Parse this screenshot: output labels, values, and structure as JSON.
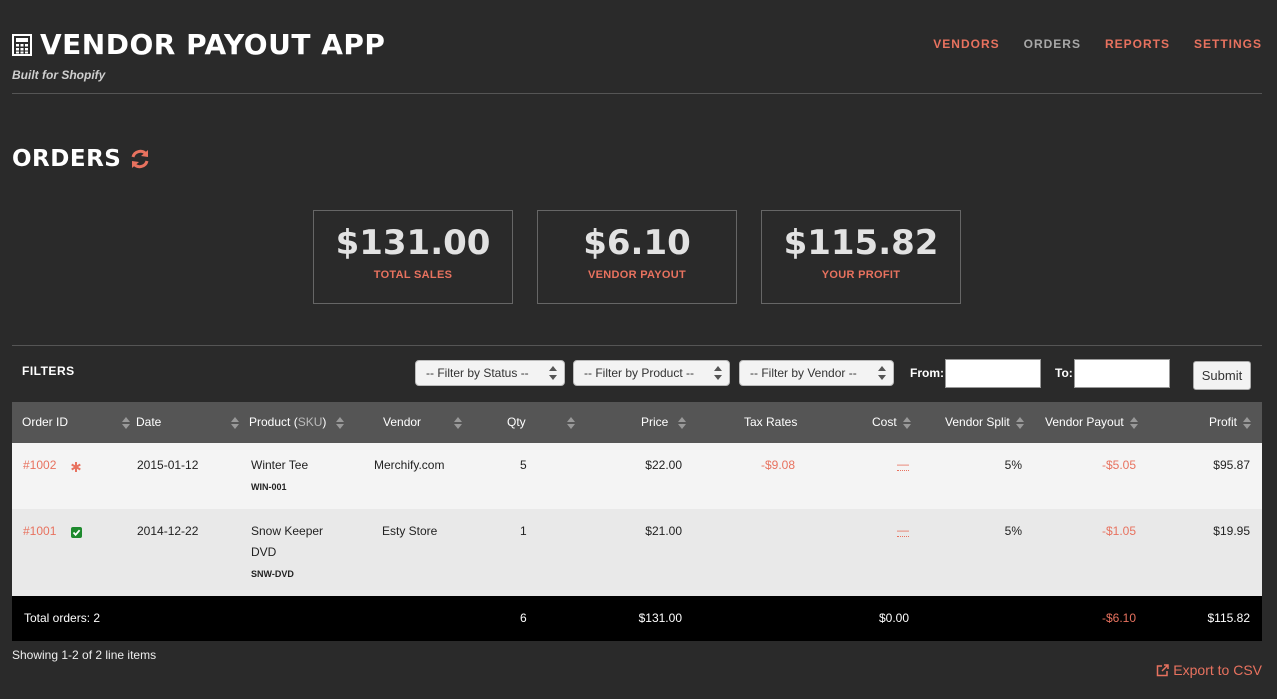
{
  "header": {
    "app_title": "VENDOR PAYOUT APP",
    "subtitle": "Built for Shopify",
    "nav": [
      {
        "label": "VENDORS",
        "active": false
      },
      {
        "label": "ORDERS",
        "active": true
      },
      {
        "label": "REPORTS",
        "active": false
      },
      {
        "label": "SETTINGS",
        "active": false
      }
    ]
  },
  "page": {
    "title": "ORDERS"
  },
  "stats": [
    {
      "value": "$131.00",
      "label": "TOTAL SALES"
    },
    {
      "value": "$6.10",
      "label": "VENDOR PAYOUT"
    },
    {
      "value": "$115.82",
      "label": "YOUR PROFIT"
    }
  ],
  "filters": {
    "label": "FILTERS",
    "status": "-- Filter by Status --",
    "product": "-- Filter by Product --",
    "vendor": "-- Filter by Vendor --",
    "from_label": "From:",
    "to_label": "To:",
    "submit": "Submit"
  },
  "table": {
    "columns": {
      "order_id": "Order ID",
      "date": "Date",
      "product": "Product (",
      "product_sku": "SKU",
      "product_close": ")",
      "vendor": "Vendor",
      "qty": "Qty",
      "price": "Price",
      "tax_rates": "Tax Rates",
      "cost": "Cost",
      "vendor_split": "Vendor Split",
      "vendor_payout": "Vendor Payout",
      "profit": "Profit"
    },
    "rows": [
      {
        "order_id": "#1002",
        "status_icon": "asterisk-icon",
        "date": "2015-01-12",
        "product_line1": "Winter Tee",
        "product_line2": "",
        "sku": "WIN-001",
        "vendor": "Merchify.com",
        "qty": "5",
        "price": "$22.00",
        "tax": "-$9.08",
        "cost": "—",
        "split": "5%",
        "payout": "-$5.05",
        "profit": "$95.87"
      },
      {
        "order_id": "#1001",
        "status_icon": "check-square-icon",
        "date": "2014-12-22",
        "product_line1": "Snow Keeper",
        "product_line2": "DVD",
        "sku": "SNW-DVD",
        "vendor": "Esty Store",
        "qty": "1",
        "price": "$21.00",
        "tax": "",
        "cost": "—",
        "split": "5%",
        "payout": "-$1.05",
        "profit": "$19.95"
      }
    ],
    "footer": {
      "total_orders": "Total orders: 2",
      "qty": "6",
      "price": "$131.00",
      "cost": "$0.00",
      "payout": "-$6.10",
      "profit": "$115.82"
    }
  },
  "showing": "Showing 1-2 of 2 line items",
  "export": "Export to CSV",
  "colors": {
    "background": "#2a2a2a",
    "accent": "#e8725f",
    "table_header": "#555555",
    "success": "#1e8a2e"
  }
}
